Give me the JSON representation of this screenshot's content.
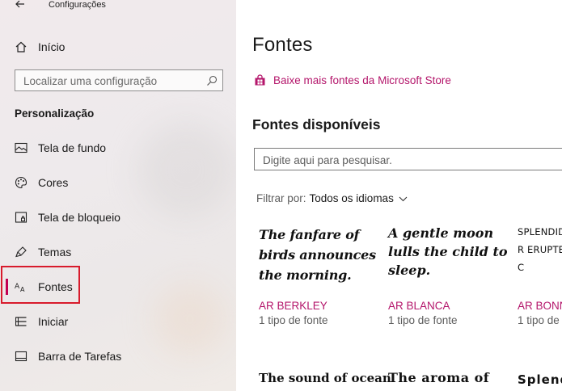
{
  "window": {
    "title": "Configurações"
  },
  "sidebar": {
    "home_label": "Início",
    "search_placeholder": "Localizar uma configuração",
    "section_label": "Personalização",
    "items": [
      {
        "label": "Tela de fundo",
        "icon": "picture-icon"
      },
      {
        "label": "Cores",
        "icon": "palette-icon"
      },
      {
        "label": "Tela de bloqueio",
        "icon": "lock-screen-icon"
      },
      {
        "label": "Temas",
        "icon": "brush-icon"
      },
      {
        "label": "Fontes",
        "icon": "fonts-icon",
        "selected": true
      },
      {
        "label": "Iniciar",
        "icon": "start-icon"
      },
      {
        "label": "Barra de Tarefas",
        "icon": "taskbar-icon"
      }
    ]
  },
  "main": {
    "title": "Fontes",
    "store_link": "Baixe mais fontes da Microsoft Store",
    "available_title": "Fontes disponíveis",
    "search_placeholder": "Digite aqui para pesquisar.",
    "filter_label": "Filtrar por:",
    "filter_value": "Todos os idiomas",
    "fonts": [
      {
        "sample": "The fanfare of birds announces the morning.",
        "name": "AR BERKLEY",
        "count": "1 tipo de fonte"
      },
      {
        "sample": "A gentle moon lulls the child to sleep.",
        "name": "AR BLANCA",
        "count": "1 tipo de fonte"
      },
      {
        "sample": "SPLENDID R ERUPTED C",
        "name": "AR BONN",
        "count": "1 tipo de"
      }
    ],
    "fonts_row2": [
      {
        "sample": "The sound of ocean"
      },
      {
        "sample": "The aroma of"
      },
      {
        "sample": "Splend"
      }
    ]
  },
  "colors": {
    "accent": "#c30052",
    "link": "#b4166b",
    "highlight": "#d81b2c"
  }
}
